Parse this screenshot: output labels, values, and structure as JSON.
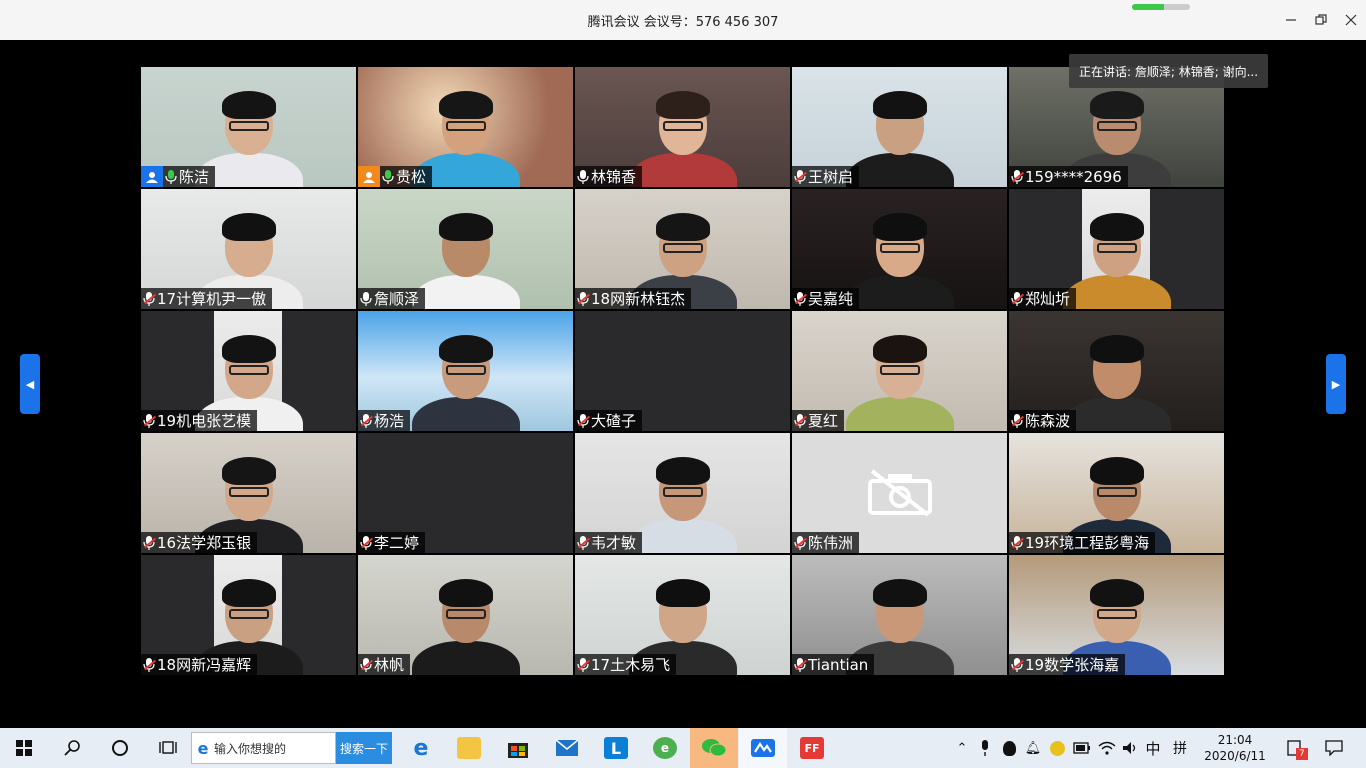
{
  "window": {
    "title": "腾讯会议 会议号：576 456 307",
    "network_level": 0.55,
    "colors": {
      "accent": "#1a73e8",
      "active_speaker": "#3cc94a",
      "mic_muted": "#e53935",
      "cohost": "#f08a1d"
    }
  },
  "speaking_banner": "正在讲话: 詹顺泽; 林锦香; 谢向...",
  "participants": [
    {
      "name": "陈洁",
      "role": "host",
      "mic": "on"
    },
    {
      "name": "贵松",
      "role": "cohost",
      "mic": "on"
    },
    {
      "name": "林锦香",
      "role": "",
      "mic": "on"
    },
    {
      "name": "王树启",
      "role": "",
      "mic": "muted"
    },
    {
      "name": "159****2696",
      "role": "",
      "mic": "muted"
    },
    {
      "name": "17计算机尹一傲",
      "role": "",
      "mic": "muted"
    },
    {
      "name": "詹顺泽",
      "role": "",
      "mic": "on",
      "active": true
    },
    {
      "name": "18网新林钰杰",
      "role": "",
      "mic": "muted"
    },
    {
      "name": "吴嘉纯",
      "role": "",
      "mic": "muted"
    },
    {
      "name": "郑灿圻",
      "role": "",
      "mic": "muted"
    },
    {
      "name": "19机电张艺模",
      "role": "",
      "mic": "muted"
    },
    {
      "name": "杨浩",
      "role": "",
      "mic": "muted"
    },
    {
      "name": "大碴子",
      "role": "",
      "mic": "muted",
      "video": "off"
    },
    {
      "name": "夏红",
      "role": "",
      "mic": "muted"
    },
    {
      "name": "陈森波",
      "role": "",
      "mic": "muted"
    },
    {
      "name": "16法学郑玉银",
      "role": "",
      "mic": "muted"
    },
    {
      "name": "李二婷",
      "role": "",
      "mic": "muted",
      "video": "off"
    },
    {
      "name": "韦才敏",
      "role": "",
      "mic": "muted"
    },
    {
      "name": "陈伟洲",
      "role": "",
      "mic": "muted",
      "video": "camera-off-icon"
    },
    {
      "name": "19环境工程彭粤海",
      "role": "",
      "mic": "muted"
    },
    {
      "name": "18网新冯嘉辉",
      "role": "",
      "mic": "muted"
    },
    {
      "name": "林帆",
      "role": "",
      "mic": "muted"
    },
    {
      "name": "17土木易飞",
      "role": "",
      "mic": "muted"
    },
    {
      "name": "Tiantian",
      "role": "",
      "mic": "muted"
    },
    {
      "name": "19数学张海嘉",
      "role": "",
      "mic": "muted"
    }
  ],
  "taskbar": {
    "search_placeholder": "输入你想搜的",
    "search_button": "搜索一下",
    "ime_lang": "中",
    "ime_mode": "拼",
    "time": "21:04",
    "date": "2020/6/11",
    "notification_count": "7"
  }
}
